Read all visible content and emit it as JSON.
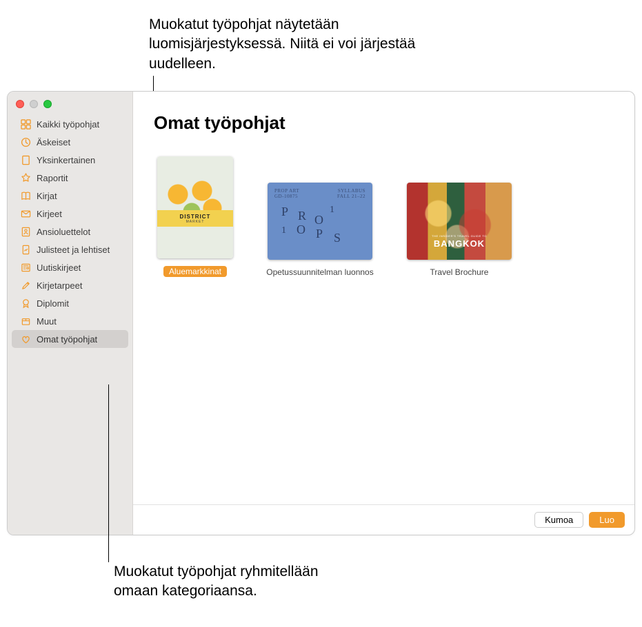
{
  "callouts": {
    "top": "Muokatut työpohjat näytetään luomisjärjestyksessä. Niitä ei voi järjestää uudelleen.",
    "bottom": "Muokatut työpohjat ryhmitellään omaan kategoriaansa."
  },
  "sidebar": {
    "items": [
      {
        "label": "Kaikki työpohjat",
        "icon": "grid-icon"
      },
      {
        "label": "Äskeiset",
        "icon": "clock-icon"
      },
      {
        "label": "Yksinkertainen",
        "icon": "doc-icon"
      },
      {
        "label": "Raportit",
        "icon": "star-icon"
      },
      {
        "label": "Kirjat",
        "icon": "book-icon"
      },
      {
        "label": "Kirjeet",
        "icon": "envelope-icon"
      },
      {
        "label": "Ansioluettelot",
        "icon": "person-icon"
      },
      {
        "label": "Julisteet ja lehtiset",
        "icon": "poster-icon"
      },
      {
        "label": "Uutiskirjeet",
        "icon": "newspaper-icon"
      },
      {
        "label": "Kirjetarpeet",
        "icon": "stationery-icon"
      },
      {
        "label": "Diplomit",
        "icon": "ribbon-icon"
      },
      {
        "label": "Muut",
        "icon": "box-icon"
      },
      {
        "label": "Omat työpohjat",
        "icon": "heart-icon",
        "selected": true
      }
    ]
  },
  "main": {
    "title": "Omat työpohjat",
    "templates": [
      {
        "label": "Aluemarkkinat",
        "selected": true,
        "thumb": {
          "line1": "DISTRICT",
          "line2": "MARKET"
        }
      },
      {
        "label": "Opetussuunnitelman luonnos",
        "thumb": {
          "hdr_left": "PROP ART\nGD-10875",
          "hdr_right": "SYLLABUS\nFALL 21–22",
          "letters": "PRO11OPS"
        }
      },
      {
        "label": "Travel Brochure",
        "thumb": {
          "subtitle": "THE INSIDER'S TRAVEL GUIDE TO",
          "title": "BANGKOK"
        }
      }
    ]
  },
  "footer": {
    "cancel": "Kumoa",
    "create": "Luo"
  },
  "icons": {
    "grid-icon": "▦",
    "clock-icon": "◷",
    "doc-icon": "▭",
    "star-icon": "✦",
    "book-icon": "▭",
    "envelope-icon": "✉",
    "person-icon": "⎚",
    "poster-icon": "▯",
    "newspaper-icon": "▤",
    "stationery-icon": "✎",
    "ribbon-icon": "◯",
    "box-icon": "▢",
    "heart-icon": "♡"
  }
}
